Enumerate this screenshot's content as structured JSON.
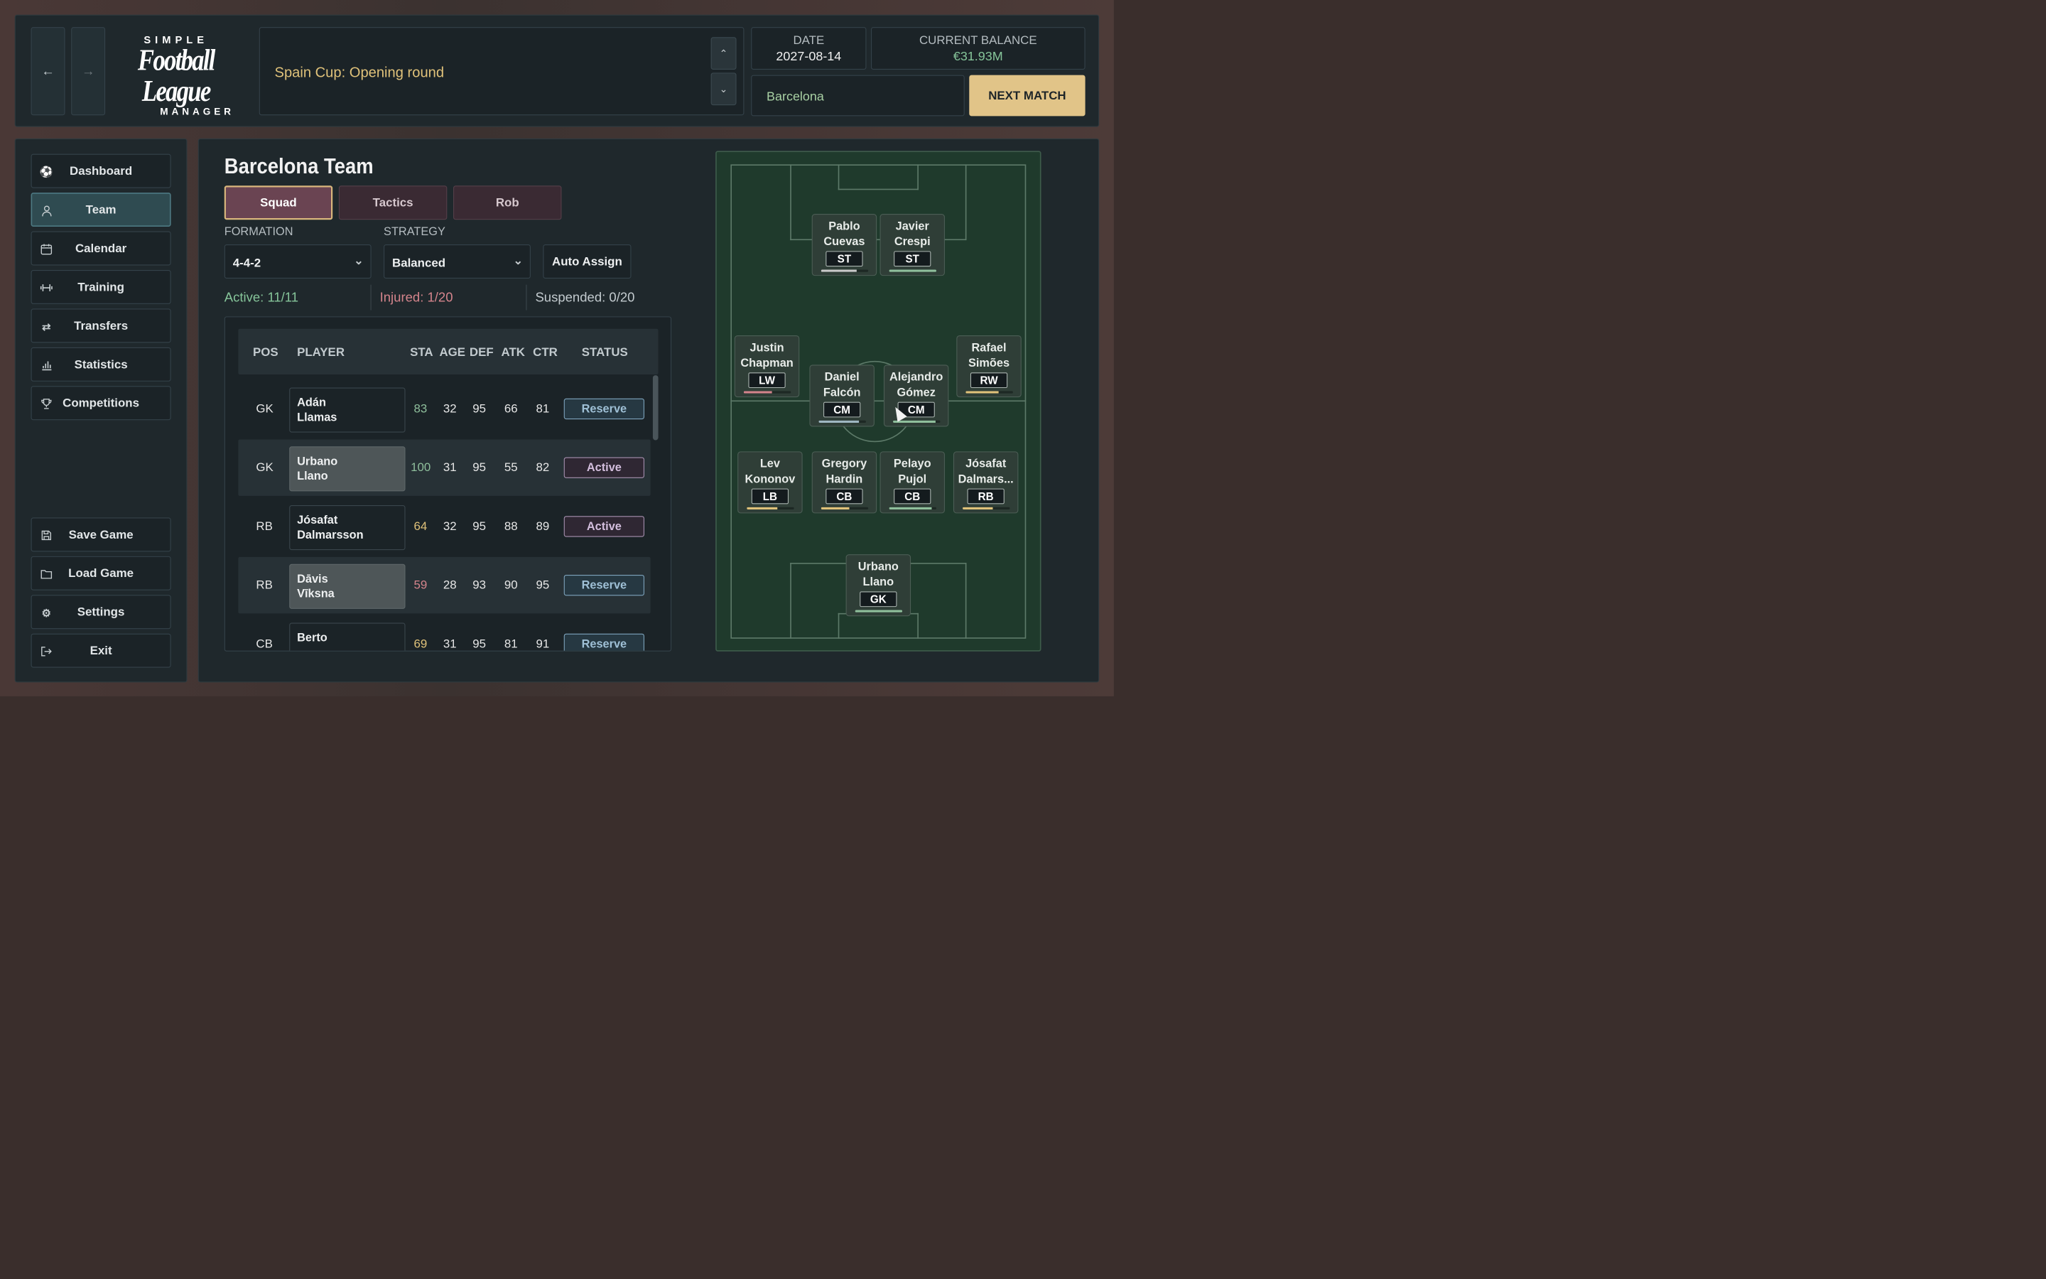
{
  "header": {
    "logo": {
      "line1": "SIMPLE",
      "line2": "Football League",
      "line3": "MANAGER"
    },
    "back_icon": "arrow-left",
    "forward_icon": "arrow-right",
    "news": "Spain Cup: Opening round",
    "date_label": "DATE",
    "date_value": "2027-08-14",
    "balance_label": "CURRENT BALANCE",
    "balance_value": "€31.93M",
    "team": "Barcelona",
    "next_match": "NEXT MATCH"
  },
  "sidebar": {
    "items": [
      {
        "label": "Dashboard",
        "icon": "soccer-ball-icon"
      },
      {
        "label": "Team",
        "icon": "person-icon"
      },
      {
        "label": "Calendar",
        "icon": "calendar-icon"
      },
      {
        "label": "Training",
        "icon": "dumbbell-icon"
      },
      {
        "label": "Transfers",
        "icon": "arrows-exchange-icon"
      },
      {
        "label": "Statistics",
        "icon": "bar-chart-icon"
      },
      {
        "label": "Competitions",
        "icon": "trophy-icon"
      }
    ],
    "bottom": [
      {
        "label": "Save Game",
        "icon": "save-icon"
      },
      {
        "label": "Load Game",
        "icon": "folder-icon"
      },
      {
        "label": "Settings",
        "icon": "gear-icon"
      },
      {
        "label": "Exit",
        "icon": "exit-icon"
      }
    ],
    "selected": "Team"
  },
  "team_page": {
    "title": "Barcelona Team",
    "tabs": [
      "Squad",
      "Tactics",
      "Rob"
    ],
    "formation_label": "FORMATION",
    "formation_value": "4-4-2",
    "strategy_label": "STRATEGY",
    "strategy_value": "Balanced",
    "auto_assign": "Auto Assign",
    "active": "Active: 11/11",
    "injured": "Injured: 1/20",
    "suspended": "Suspended: 0/20"
  },
  "table": {
    "headers": [
      "POS",
      "PLAYER",
      "STA",
      "AGE",
      "DEF",
      "ATK",
      "CTR",
      "STATUS"
    ],
    "rows": [
      {
        "pos": "GK",
        "first": "Adán",
        "last": "Llamas",
        "sta": "83",
        "age": "32",
        "def": "95",
        "atk": "66",
        "ctr": "81",
        "status": "Reserve"
      },
      {
        "pos": "GK",
        "first": "Urbano",
        "last": "Llano",
        "sta": "100",
        "age": "31",
        "def": "95",
        "atk": "55",
        "ctr": "82",
        "status": "Active"
      },
      {
        "pos": "RB",
        "first": "Jósafat",
        "last": "Dalmarsson",
        "sta": "64",
        "age": "32",
        "def": "95",
        "atk": "88",
        "ctr": "89",
        "status": "Active"
      },
      {
        "pos": "RB",
        "first": "Dāvis",
        "last": "Vīksna",
        "sta": "59",
        "age": "28",
        "def": "93",
        "atk": "90",
        "ctr": "95",
        "status": "Reserve"
      },
      {
        "pos": "CB",
        "first": "Berto",
        "last": "",
        "sta": "69",
        "age": "31",
        "def": "95",
        "atk": "81",
        "ctr": "91",
        "status": "Reserve"
      }
    ]
  },
  "pitch": {
    "players": [
      {
        "first": "Pablo",
        "last": "Cuevas",
        "pos": "ST",
        "stamina": 0.75,
        "bar_color": "#c9c9c9"
      },
      {
        "first": "Javier",
        "last": "Crespi",
        "pos": "ST",
        "stamina": 1.0,
        "bar_color": "#8fbf9c"
      },
      {
        "first": "Justin",
        "last": "Chapman",
        "pos": "LW",
        "stamina": 0.6,
        "bar_color": "#d4848c"
      },
      {
        "first": "Daniel",
        "last": "Falcón",
        "pos": "CM",
        "stamina": 0.85,
        "bar_color": "#9fb7c2"
      },
      {
        "first": "Alejandro",
        "last": "Gómez",
        "pos": "CM",
        "stamina": 0.9,
        "bar_color": "#8fbf9c"
      },
      {
        "first": "Rafael",
        "last": "Simões",
        "pos": "RW",
        "stamina": 0.7,
        "bar_color": "#e0c27a"
      },
      {
        "first": "Lev",
        "last": "Kononov",
        "pos": "LB",
        "stamina": 0.65,
        "bar_color": "#e0c27a"
      },
      {
        "first": "Gregory",
        "last": "Hardin",
        "pos": "CB",
        "stamina": 0.6,
        "bar_color": "#e0c27a"
      },
      {
        "first": "Pelayo",
        "last": "Pujol",
        "pos": "CB",
        "stamina": 0.9,
        "bar_color": "#8fbf9c"
      },
      {
        "first": "Jósafat",
        "last": "Dalmars...",
        "pos": "RB",
        "stamina": 0.64,
        "bar_color": "#e0c27a"
      },
      {
        "first": "Urbano",
        "last": "Llano",
        "pos": "GK",
        "stamina": 1.0,
        "bar_color": "#8fbf9c"
      }
    ]
  },
  "colors": {
    "accent": "#e1c488",
    "active_green": "#86c59a",
    "injured_red": "#d4848c",
    "stamina_low": "#d4848c",
    "stamina_mid": "#e0c27a",
    "stamina_high": "#8fbf9c"
  }
}
